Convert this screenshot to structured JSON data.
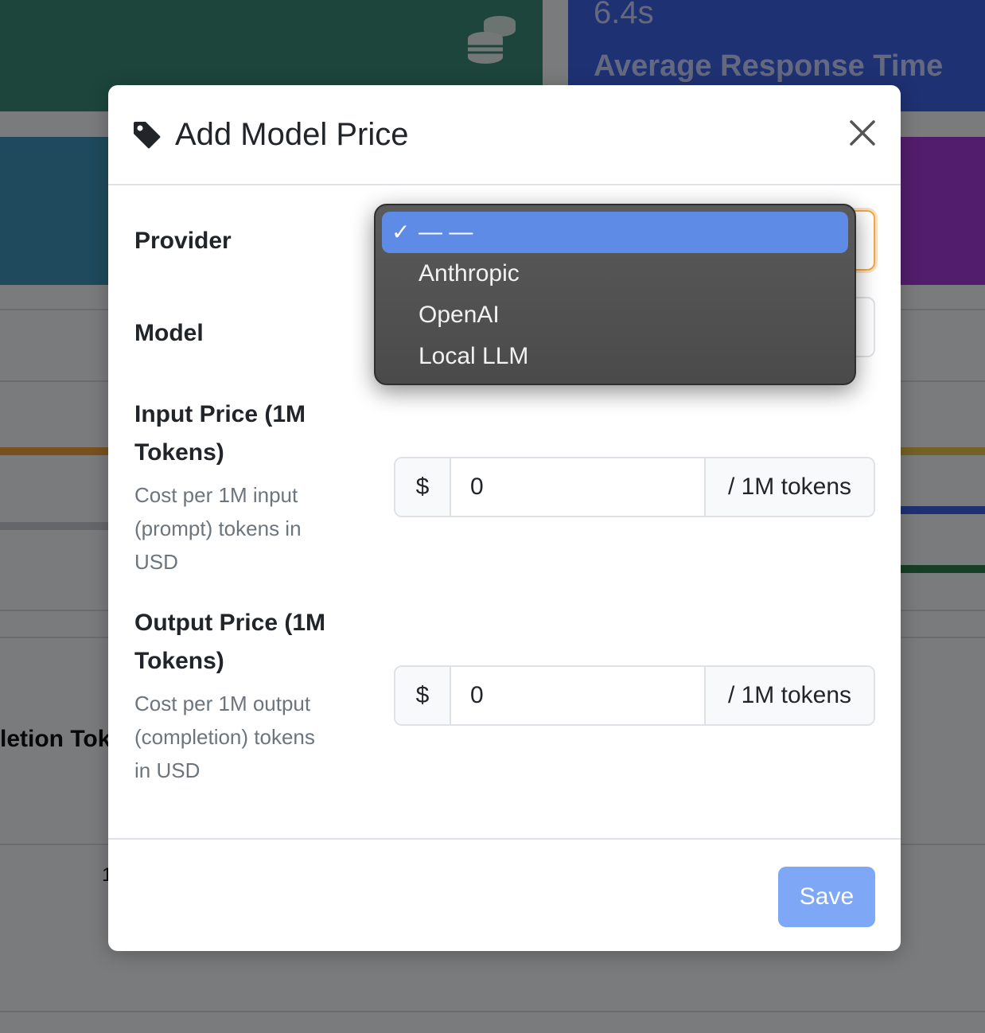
{
  "background": {
    "metric_value": "6.4s",
    "metric_label": "Average Response Time",
    "partial_header": "letion Tok",
    "partial_number": "1"
  },
  "modal": {
    "title": "Add Model Price",
    "icon": "tag-icon",
    "fields": {
      "provider_label": "Provider",
      "model_label": "Model",
      "input_price_label_1": "Input Price (1M",
      "input_price_label_2": "Tokens)",
      "input_price_help_1": "Cost per 1M input",
      "input_price_help_2": "(prompt) tokens in",
      "input_price_help_3": "USD",
      "input_price_prefix": "$",
      "input_price_value": "0",
      "input_price_suffix": "/ 1M tokens",
      "output_price_label_1": "Output Price (1M",
      "output_price_label_2": "Tokens)",
      "output_price_help_1": "Cost per 1M output",
      "output_price_help_2": "(completion) tokens",
      "output_price_help_3": "in USD",
      "output_price_prefix": "$",
      "output_price_value": "0",
      "output_price_suffix": "/ 1M tokens"
    },
    "save_label": "Save"
  },
  "provider_dropdown": {
    "options": [
      {
        "label": "— —",
        "selected": true
      },
      {
        "label": "Anthropic",
        "selected": false
      },
      {
        "label": "OpenAI",
        "selected": false
      },
      {
        "label": "Local LLM",
        "selected": false
      }
    ],
    "check_mark": "✓"
  },
  "colors": {
    "primary_button": "#7ea7f6",
    "selected_option": "#5d8be6",
    "focus_border": "#f0a94b"
  }
}
